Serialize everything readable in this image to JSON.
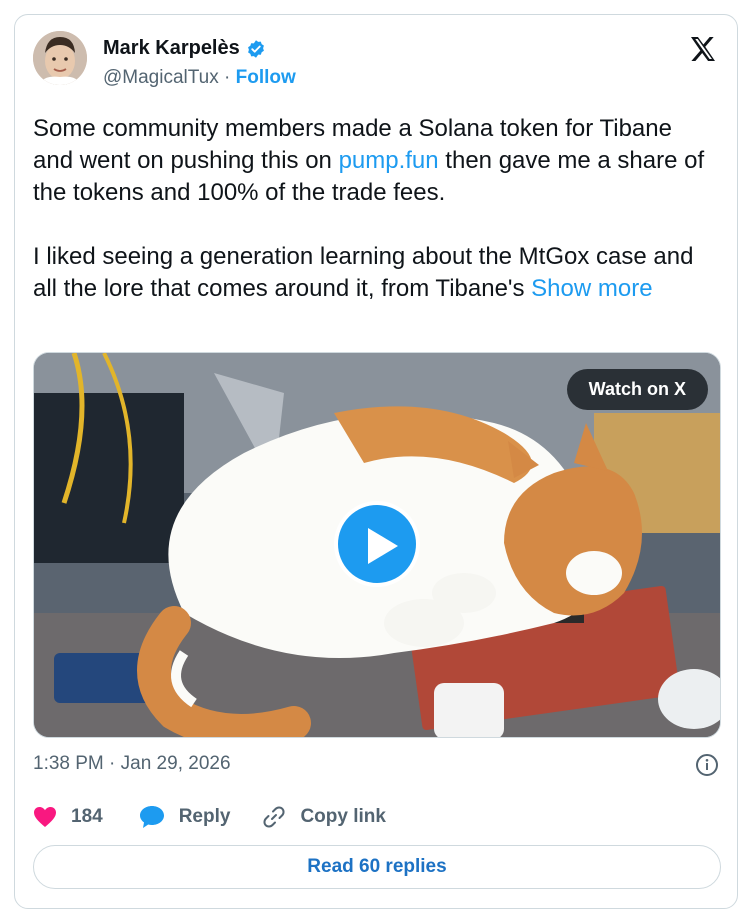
{
  "author": {
    "name": "Mark Karpelès",
    "handle": "@MagicalTux",
    "separator": "·",
    "follow_label": "Follow"
  },
  "tweet": {
    "text_part1": "Some community members made a Solana token for Tibane and went on pushing this on ",
    "link_text": "pump.fun",
    "text_part2": " then gave me a share of the tokens and 100% of the trade fees.",
    "text_para2": "I liked seeing a generation learning about the MtGox case and all the lore that comes around it, from Tibane's ",
    "show_more": "Show more"
  },
  "media": {
    "watch_label": "Watch on X",
    "play_icon": "play-icon"
  },
  "meta": {
    "timestamp": "1:38 PM · Jan 29, 2026"
  },
  "actions": {
    "like_count": "184",
    "reply_label": "Reply",
    "copy_label": "Copy link"
  },
  "footer": {
    "replies_label": "Read 60 replies"
  },
  "colors": {
    "accent": "#1d9bf0",
    "like": "#f91880",
    "muted": "#536471"
  }
}
